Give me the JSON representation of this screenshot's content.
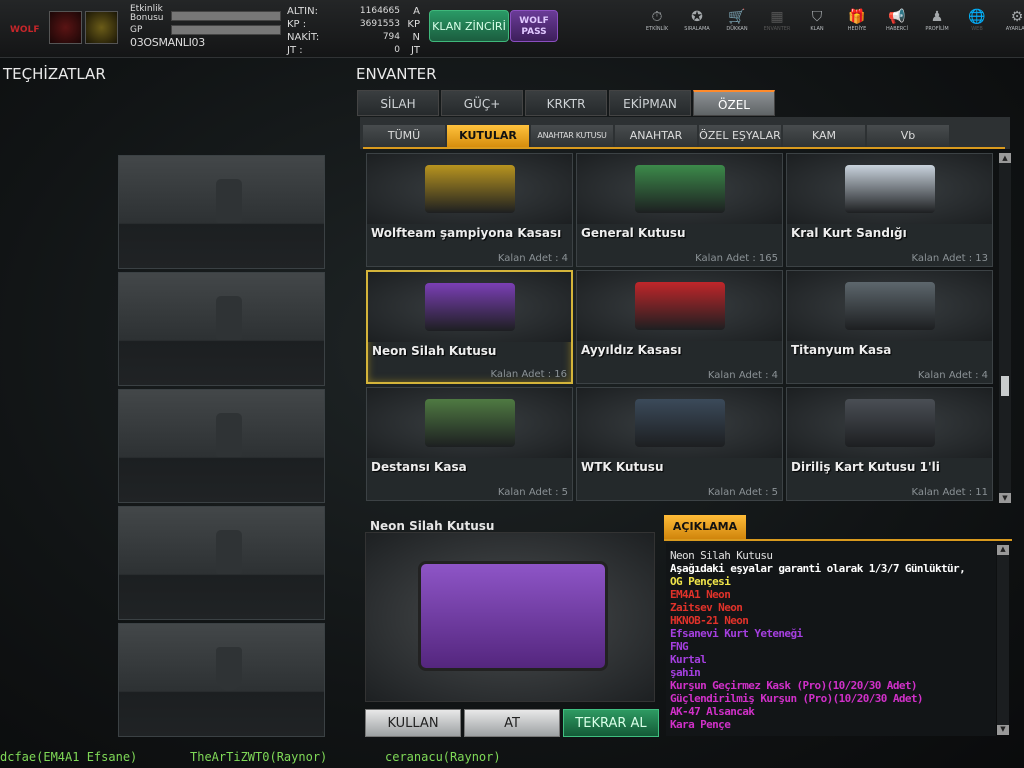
{
  "header": {
    "etkinlik_label": "Etkinlik Bonusu",
    "gp_label": "GP",
    "username": "03OSMANLI03",
    "logo_text": "WOLF",
    "stats": [
      {
        "label": "ALTIN:",
        "value": "1164665",
        "unit": "A"
      },
      {
        "label": "KP  :",
        "value": "3691553",
        "unit": "KP"
      },
      {
        "label": "NAKİT:",
        "value": "794",
        "unit": "N"
      },
      {
        "label": "JT  :",
        "value": "0",
        "unit": "JT"
      }
    ],
    "klan_button": "KLAN ZİNCİRİ",
    "wolf_button": "WOLF PASS",
    "nav": [
      {
        "label": "ETKİNLİK",
        "icon": "stopwatch-icon",
        "glyph": "⏱"
      },
      {
        "label": "SIRALAMA",
        "icon": "medal-icon",
        "glyph": "✪"
      },
      {
        "label": "DÜKKAN",
        "icon": "cart-icon",
        "glyph": "🛒"
      },
      {
        "label": "ENVANTER",
        "icon": "inventory-icon",
        "glyph": "▦"
      },
      {
        "label": "KLAN",
        "icon": "shield-icon",
        "glyph": "⛉"
      },
      {
        "label": "HEDİYE",
        "icon": "gift-icon",
        "glyph": "🎁"
      },
      {
        "label": "HABERCİ",
        "icon": "megaphone-icon",
        "glyph": "📢"
      },
      {
        "label": "PROFİLİM",
        "icon": "profile-icon",
        "glyph": "♟"
      },
      {
        "label": "WEB",
        "icon": "globe-icon",
        "glyph": "🌐"
      },
      {
        "label": "AYARLAR",
        "icon": "gear-icon",
        "glyph": "⚙"
      },
      {
        "label": "GERİ",
        "icon": "back-icon",
        "glyph": "«"
      }
    ]
  },
  "left_title": "TEÇHİZATLAR",
  "right_title": "ENVANTER",
  "main_tabs": [
    "SİLAH",
    "GÜÇ+",
    "KRKTR",
    "EKİPMAN",
    "ÖZEL"
  ],
  "sub_tabs": [
    "TÜMÜ",
    "KUTULAR",
    "ANAHTAR KUTUSU",
    "ANAHTAR",
    "ÖZEL EŞYALAR",
    "KAM",
    "Vb"
  ],
  "items": [
    {
      "name": "Wolfteam şampiyona Kasası",
      "count": "Kalan Adet : 4",
      "color": "#b8941f"
    },
    {
      "name": "General Kutusu",
      "count": "Kalan Adet : 165",
      "color": "#3c8a4a"
    },
    {
      "name": "Kral Kurt Sandığı",
      "count": "Kalan Adet : 13",
      "color": "#c9d3dd"
    },
    {
      "name": "Neon Silah Kutusu",
      "count": "Kalan Adet : 16",
      "color": "#7b3fb5"
    },
    {
      "name": "Ayyıldız Kasası",
      "count": "Kalan Adet : 4",
      "color": "#c0262a"
    },
    {
      "name": "Titanyum Kasa",
      "count": "Kalan Adet : 4",
      "color": "#5d676d"
    },
    {
      "name": "Destansı Kasa",
      "count": "Kalan Adet : 5",
      "color": "#4f7a42"
    },
    {
      "name": "WTK Kutusu",
      "count": "Kalan Adet : 5",
      "color": "#3b4a5a"
    },
    {
      "name": "Diriliş Kart Kutusu 1'li",
      "count": "Kalan Adet : 11",
      "color": "#4a4f55"
    }
  ],
  "detail": {
    "title": "Neon Silah Kutusu",
    "buttons": [
      "KULLAN",
      "AT",
      "TEKRAR AL"
    ],
    "desc_tab": "AÇIKLAMA",
    "lines": [
      {
        "t": "Neon Silah Kutusu",
        "c": "#e0e0e0"
      },
      {
        "t": "Aşağıdaki eşyalar garanti olarak 1/3/7 Günlüktür,",
        "c": "#ffffff"
      },
      {
        "t": "OG Pençesi",
        "c": "#f0e54a"
      },
      {
        "t": "EM4A1 Neon",
        "c": "#e0322a"
      },
      {
        "t": "Zaitsev Neon",
        "c": "#e0322a"
      },
      {
        "t": "HKNOB-21 Neon",
        "c": "#e0322a"
      },
      {
        "t": "Efsanevi Kurt Yeteneği",
        "c": "#a53fe0"
      },
      {
        "t": "FNG",
        "c": "#a53fe0"
      },
      {
        "t": "Kurtal",
        "c": "#a53fe0"
      },
      {
        "t": "şahin",
        "c": "#a53fe0"
      },
      {
        "t": "Kurşun Geçirmez Kask (Pro)(10/20/30 Adet)",
        "c": "#d030c8"
      },
      {
        "t": "Güçlendirilmiş Kurşun (Pro)(10/20/30 Adet)",
        "c": "#d030c8"
      },
      {
        "t": "AK-47 Alsancak",
        "c": "#d030c8"
      },
      {
        "t": "Kara Pençe",
        "c": "#d030c8"
      }
    ]
  },
  "chat": [
    "dcfae(EM4A1 Efsane)",
    "TheArTiZWT0(Raynor)",
    "ceranacu(Raynor)"
  ]
}
